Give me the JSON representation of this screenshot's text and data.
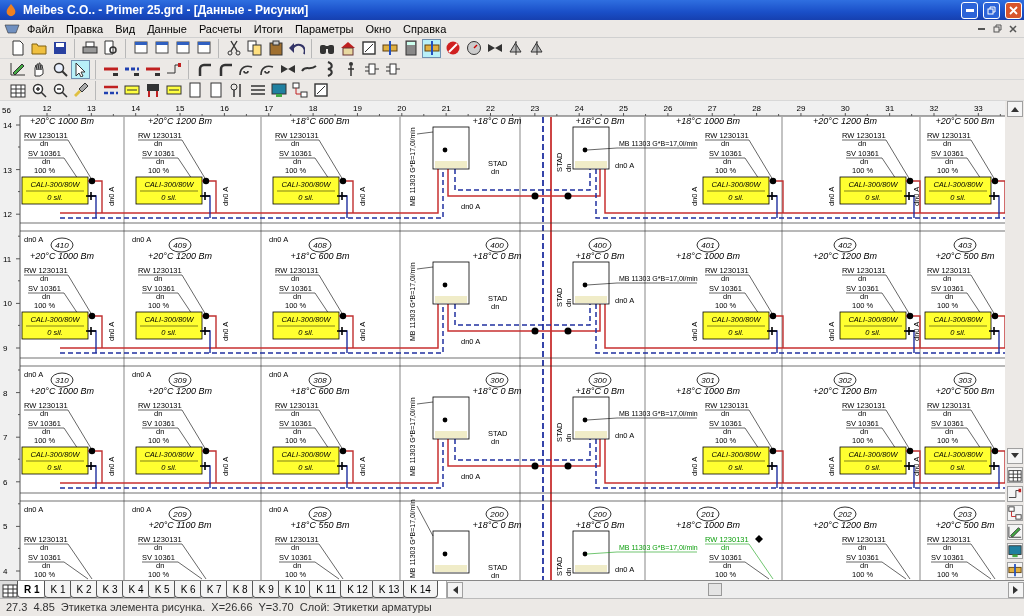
{
  "window": {
    "title": "Meibes C.O.. - Primer 25.grd - [Данные - Рисунки]"
  },
  "menu": [
    "Файл",
    "Правка",
    "Вид",
    "Данные",
    "Расчеты",
    "Итоги",
    "Параметры",
    "Окно",
    "Справка"
  ],
  "toolbars": [
    {
      "groups": [
        [
          {
            "kind": "document",
            "selected": false
          },
          {
            "kind": "folder",
            "selected": false
          },
          {
            "kind": "disk",
            "selected": false
          }
        ],
        [
          {
            "kind": "printer",
            "selected": false
          },
          {
            "kind": "preview",
            "selected": false
          }
        ],
        [
          {
            "kind": "window",
            "selected": false
          },
          {
            "kind": "window",
            "selected": false
          },
          {
            "kind": "window",
            "selected": false
          },
          {
            "kind": "window",
            "selected": false
          }
        ],
        [
          {
            "kind": "scissors",
            "selected": false
          },
          {
            "kind": "copy",
            "selected": false
          },
          {
            "kind": "clipboard",
            "selected": false
          },
          {
            "kind": "undo",
            "selected": false
          }
        ],
        [
          {
            "kind": "binoculars",
            "selected": false
          },
          {
            "kind": "house",
            "selected": false
          },
          {
            "kind": "frame",
            "selected": false
          },
          {
            "kind": "fitting",
            "selected": false
          },
          {
            "kind": "calculator",
            "selected": false
          },
          {
            "kind": "fitting",
            "selected": true
          },
          {
            "kind": "stop",
            "selected": false
          },
          {
            "kind": "gauge",
            "selected": false
          },
          {
            "kind": "valve",
            "selected": false
          },
          {
            "kind": "sail",
            "selected": false
          },
          {
            "kind": "sail",
            "selected": false
          }
        ]
      ]
    },
    {
      "groups": [
        [
          {
            "kind": "pen",
            "selected": false
          },
          {
            "kind": "hand",
            "selected": false
          },
          {
            "kind": "zoom",
            "selected": false
          },
          {
            "kind": "pointer",
            "selected": true
          }
        ],
        [
          {
            "kind": "redline",
            "selected": false
          },
          {
            "kind": "blueline",
            "selected": false
          },
          {
            "kind": "redline",
            "selected": false
          },
          {
            "kind": "connector",
            "selected": false
          }
        ],
        [
          {
            "kind": "bend",
            "selected": false
          },
          {
            "kind": "bend",
            "selected": false
          },
          {
            "kind": "curl",
            "selected": false
          },
          {
            "kind": "curl",
            "selected": false
          },
          {
            "kind": "valve",
            "selected": false
          },
          {
            "kind": "wave",
            "selected": false
          },
          {
            "kind": "hook",
            "selected": false
          },
          {
            "kind": "pin",
            "selected": false
          },
          {
            "kind": "manifold",
            "selected": false
          },
          {
            "kind": "manifold",
            "selected": false
          }
        ]
      ]
    },
    {
      "groups": [
        [
          {
            "kind": "grid",
            "selected": false
          },
          {
            "kind": "zoomin",
            "selected": false
          },
          {
            "kind": "zoomout",
            "selected": false
          },
          {
            "kind": "brush",
            "selected": false
          }
        ],
        [
          {
            "kind": "dualline",
            "selected": false
          },
          {
            "kind": "label",
            "selected": false
          },
          {
            "kind": "pump",
            "selected": false
          },
          {
            "kind": "label",
            "selected": false
          },
          {
            "kind": "panel",
            "selected": false
          },
          {
            "kind": "panel",
            "selected": false
          },
          {
            "kind": "probe",
            "selected": false
          },
          {
            "kind": "list",
            "selected": false
          },
          {
            "kind": "monitor",
            "selected": false
          },
          {
            "kind": "tree",
            "selected": false
          },
          {
            "kind": "frame",
            "selected": false
          }
        ]
      ]
    }
  ],
  "ruler": {
    "corner": "56",
    "columns": [
      "12",
      "13",
      "14",
      "15",
      "16",
      "17",
      "18",
      "19",
      "20",
      "21",
      "22",
      "23",
      "24",
      "25",
      "26",
      "27",
      "28",
      "29",
      "30",
      "31",
      "32",
      "33"
    ],
    "rows": [
      "14",
      "13",
      "12",
      "11",
      "10",
      "9",
      "8",
      "7",
      "6",
      "5",
      "4"
    ]
  },
  "bands": [
    {
      "rooms": [
        {
          "kind": "radiator",
          "temp": "+20°C 1000 Вт",
          "valve_top": "RW 1230131",
          "valve_top_size": "dn",
          "valve_bottom": "SV 10361",
          "valve_bottom_size": "dn",
          "setting": "100 %",
          "radiator": "CALI-300/80W",
          "radiator_sub": "0 sil.",
          "pipe_label": "dn0 A",
          "line_label": "dn0 A",
          "highlighted": false
        },
        {
          "kind": "radiator",
          "temp": "+20°C 1200 Вт",
          "valve_top": "RW 1230131",
          "valve_top_size": "dn",
          "valve_bottom": "SV 10361",
          "valve_bottom_size": "dn",
          "setting": "100 %",
          "radiator": "CALI-300/80W",
          "radiator_sub": "0 sil.",
          "pipe_label": "dn0 A",
          "line_label": "dn0 A",
          "highlighted": false
        },
        {
          "kind": "radiator",
          "temp": "+18°C 600 Вт",
          "valve_top": "RW 1230131",
          "valve_top_size": "dn",
          "valve_bottom": "SV 10361",
          "valve_bottom_size": "dn",
          "setting": "100 %",
          "radiator": "CALI-300/80W",
          "radiator_sub": "0 sil.",
          "pipe_label": "dn0 A",
          "line_label": "dn0 A",
          "highlighted": false
        },
        {
          "kind": "riser",
          "temp": "+18°C 0 Вт",
          "meter": "MB 11303 G*B=17,0l/min",
          "valve": "STAD",
          "valve_size": "dn",
          "pipe_label": "dn0 A",
          "highlighted": false
        },
        {
          "kind": "riser",
          "temp": "+18°C 0 Вт",
          "meter": "MB 11303 G*B=17,0l/min",
          "valve": "STAD",
          "valve_size": "dn",
          "pipe_label": "dn0 A",
          "highlighted": false
        },
        {
          "kind": "radiator",
          "temp": "+18°C 1000 Вт",
          "valve_top": "RW 1230131",
          "valve_top_size": "dn",
          "valve_bottom": "SV 10361",
          "valve_bottom_size": "dn",
          "setting": "100 %",
          "radiator": "CALI-300/80W",
          "radiator_sub": "0 sil.",
          "pipe_label": "dn0 A",
          "highlighted": false
        },
        {
          "kind": "radiator",
          "temp": "+20°C 1200 Вт",
          "valve_top": "RW 1230131",
          "valve_top_size": "dn",
          "valve_bottom": "SV 10361",
          "valve_bottom_size": "dn",
          "setting": "100 %",
          "radiator": "CALI-300/80W",
          "radiator_sub": "0 sil.",
          "pipe_label": "dn0 A",
          "highlighted": false
        },
        {
          "kind": "radiator",
          "temp": "+20°C 500 Вт",
          "valve_top": "RW 1230131",
          "valve_top_size": "dn",
          "valve_bottom": "SV 10361",
          "valve_bottom_size": "dn",
          "setting": "100 %",
          "radiator": "CALI-300/80W",
          "radiator_sub": "0 sil.",
          "pipe_label": "dn0 A",
          "highlighted": false
        }
      ]
    },
    {
      "rooms": [
        {
          "kind": "radiator",
          "number": "410",
          "temp": "+20°C 1000 Вт",
          "valve_top": "RW 1230131",
          "valve_top_size": "dn",
          "valve_bottom": "SV 10361",
          "valve_bottom_size": "dn",
          "setting": "100 %",
          "radiator": "CALI-300/80W",
          "radiator_sub": "0 sil.",
          "pipe_label": "dn0 A",
          "line_label": "dn0 A",
          "highlighted": false
        },
        {
          "kind": "radiator",
          "number": "409",
          "temp": "+20°C 1200 Вт",
          "valve_top": "RW 1230131",
          "valve_top_size": "dn",
          "valve_bottom": "SV 10361",
          "valve_bottom_size": "dn",
          "setting": "100 %",
          "radiator": "CALI-300/80W",
          "radiator_sub": "0 sil.",
          "pipe_label": "dn0 A",
          "line_label": "dn0 A",
          "highlighted": false
        },
        {
          "kind": "radiator",
          "number": "408",
          "temp": "+18°C 600 Вт",
          "valve_top": "RW 1230131",
          "valve_top_size": "dn",
          "valve_bottom": "SV 10361",
          "valve_bottom_size": "dn",
          "setting": "100 %",
          "radiator": "CALI-300/80W",
          "radiator_sub": "0 sil.",
          "pipe_label": "dn0 A",
          "line_label": "dn0 A",
          "highlighted": false
        },
        {
          "kind": "riser",
          "number": "400",
          "temp": "+18°C 0 Вт",
          "meter": "MB 11303 G*B=17,0l/min",
          "valve": "STAD",
          "valve_size": "dn",
          "pipe_label": "dn0 A",
          "highlighted": false
        },
        {
          "kind": "riser",
          "number": "400",
          "temp": "+18°C 0 Вт",
          "meter": "MB 11303 G*B=17,0l/min",
          "valve": "STAD",
          "valve_size": "dn",
          "pipe_label": "dn0 A",
          "highlighted": false
        },
        {
          "kind": "radiator",
          "number": "401",
          "temp": "+18°C 1000 Вт",
          "valve_top": "RW 1230131",
          "valve_top_size": "dn",
          "valve_bottom": "SV 10361",
          "valve_bottom_size": "dn",
          "setting": "100 %",
          "radiator": "CALI-300/80W",
          "radiator_sub": "0 sil.",
          "pipe_label": "dn0 A",
          "highlighted": false
        },
        {
          "kind": "radiator",
          "number": "402",
          "temp": "+20°C 1200 Вт",
          "valve_top": "RW 1230131",
          "valve_top_size": "dn",
          "valve_bottom": "SV 10361",
          "valve_bottom_size": "dn",
          "setting": "100 %",
          "radiator": "CALI-300/80W",
          "radiator_sub": "0 sil.",
          "pipe_label": "dn0 A",
          "highlighted": false
        },
        {
          "kind": "radiator",
          "number": "403",
          "temp": "+20°C 500 Вт",
          "valve_top": "RW 1230131",
          "valve_top_size": "dn",
          "valve_bottom": "SV 10361",
          "valve_bottom_size": "dn",
          "setting": "100 %",
          "radiator": "CALI-300/80W",
          "radiator_sub": "0 sil.",
          "pipe_label": "dn0 A",
          "highlighted": false
        }
      ]
    },
    {
      "rooms": [
        {
          "kind": "radiator",
          "number": "310",
          "temp": "+20°C 1000 Вт",
          "valve_top": "RW 1230131",
          "valve_top_size": "dn",
          "valve_bottom": "SV 10361",
          "valve_bottom_size": "dn",
          "setting": "100 %",
          "radiator": "CALI-300/80W",
          "radiator_sub": "0 sil.",
          "pipe_label": "dn0 A",
          "line_label": "dn0 A",
          "highlighted": false
        },
        {
          "kind": "radiator",
          "number": "309",
          "temp": "+20°C 1200 Вт",
          "valve_top": "RW 1230131",
          "valve_top_size": "dn",
          "valve_bottom": "SV 10361",
          "valve_bottom_size": "dn",
          "setting": "100 %",
          "radiator": "CALI-300/80W",
          "radiator_sub": "0 sil.",
          "pipe_label": "dn0 A",
          "line_label": "dn0 A",
          "highlighted": false
        },
        {
          "kind": "radiator",
          "number": "308",
          "temp": "+18°C 600 Вт",
          "valve_top": "RW 1230131",
          "valve_top_size": "dn",
          "valve_bottom": "SV 10361",
          "valve_bottom_size": "dn",
          "setting": "100 %",
          "radiator": "CALI-300/80W",
          "radiator_sub": "0 sil.",
          "pipe_label": "dn0 A",
          "line_label": "dn0 A",
          "highlighted": false
        },
        {
          "kind": "riser",
          "number": "300",
          "temp": "+18°C 0 Вт",
          "meter": "MB 11303 G*B=17,0l/min",
          "valve": "STAD",
          "valve_size": "dn",
          "pipe_label": "dn0 A",
          "highlighted": false
        },
        {
          "kind": "riser",
          "number": "300",
          "temp": "+18°C 0 Вт",
          "meter": "MB 11303 G*B=17,0l/min",
          "valve": "STAD",
          "valve_size": "dn",
          "pipe_label": "dn0 A",
          "highlighted": false
        },
        {
          "kind": "radiator",
          "number": "301",
          "temp": "+18°C 1000 Вт",
          "valve_top": "RW 1230131",
          "valve_top_size": "dn",
          "valve_bottom": "SV 10361",
          "valve_bottom_size": "dn",
          "setting": "100 %",
          "radiator": "CALI-300/80W",
          "radiator_sub": "0 sil.",
          "pipe_label": "dn0 A",
          "highlighted": false
        },
        {
          "kind": "radiator",
          "number": "302",
          "temp": "+20°C 1200 Вт",
          "valve_top": "RW 1230131",
          "valve_top_size": "dn",
          "valve_bottom": "SV 10361",
          "valve_bottom_size": "dn",
          "setting": "100 %",
          "radiator": "CALI-300/80W",
          "radiator_sub": "0 sil.",
          "pipe_label": "dn0 A",
          "highlighted": false
        },
        {
          "kind": "radiator",
          "number": "303",
          "temp": "+20°C 500 Вт",
          "valve_top": "RW 1230131",
          "valve_top_size": "dn",
          "valve_bottom": "SV 10361",
          "valve_bottom_size": "dn",
          "setting": "100 %",
          "radiator": "CALI-300/80W",
          "radiator_sub": "0 sil.",
          "pipe_label": "dn0 A",
          "highlighted": false
        }
      ]
    },
    {
      "rooms": [
        {
          "kind": "radiator",
          "valve_top": "RW 1230131",
          "valve_top_size": "dn",
          "valve_bottom": "SV 10361",
          "valve_bottom_size": "dn",
          "setting": "100 %",
          "highlighted": false
        },
        {
          "kind": "radiator",
          "number": "209",
          "temp": "+20°C 1100 Вт",
          "valve_top": "RW 1230131",
          "valve_top_size": "dn",
          "valve_bottom": "SV 10361",
          "valve_bottom_size": "dn",
          "setting": "100 %",
          "highlighted": false
        },
        {
          "kind": "radiator",
          "number": "208",
          "temp": "+18°C 550 Вт",
          "valve_top": "RW 1230131",
          "valve_top_size": "dn",
          "valve_bottom": "SV 10361",
          "valve_bottom_size": "dn",
          "setting": "100 %",
          "highlighted": false
        },
        {
          "kind": "riser",
          "number": "200",
          "temp": "+18°C 0 Вт",
          "meter": "MB 11303 G*B=17,0l/min",
          "valve": "STAD",
          "valve_size": "dn",
          "highlighted": false
        },
        {
          "kind": "riser",
          "number": "200",
          "temp": "+18°C 0 Вт",
          "meter": "MB 11303 G*B=17,0l/min",
          "valve": "STAD",
          "valve_size": "dn",
          "pipe_label": "dn0 A",
          "highlighted": true
        },
        {
          "kind": "radiator",
          "number": "201",
          "temp": "+18°C 1000 Вт",
          "valve_top": "RW 1230131",
          "valve_top_size": "dn",
          "valve_bottom": "SV 10361",
          "valve_bottom_size": "dn",
          "setting": "100 %",
          "highlighted": true
        },
        {
          "kind": "radiator",
          "number": "202",
          "temp": "+20°C 1200 Вт",
          "valve_top": "RW 1230131",
          "valve_top_size": "dn",
          "valve_bottom": "SV 10361",
          "valve_bottom_size": "dn",
          "setting": "100 %",
          "highlighted": false
        },
        {
          "kind": "radiator",
          "number": "203",
          "temp": "+20°C 500 Вт",
          "valve_top": "RW 1230131",
          "valve_top_size": "dn",
          "valve_bottom": "SV 10361",
          "valve_bottom_size": "dn",
          "setting": "100 %",
          "highlighted": false
        }
      ]
    }
  ],
  "sheet_tabs": [
    {
      "label": "R 1",
      "selected": true
    },
    {
      "label": "K 1",
      "selected": false
    },
    {
      "label": "K 2",
      "selected": false
    },
    {
      "label": "K 3",
      "selected": false
    },
    {
      "label": "K 4",
      "selected": false
    },
    {
      "label": "K 5",
      "selected": false
    },
    {
      "label": "K 6",
      "selected": false
    },
    {
      "label": "K 7",
      "selected": false
    },
    {
      "label": "K 8",
      "selected": false
    },
    {
      "label": "K 9",
      "selected": false
    },
    {
      "label": "K 10",
      "selected": false
    },
    {
      "label": "K 11",
      "selected": false
    },
    {
      "label": "K 12",
      "selected": false
    },
    {
      "label": "K 13",
      "selected": false
    },
    {
      "label": "K 14",
      "selected": false
    }
  ],
  "status_bar": {
    "fields": [
      "27.3",
      "4.85"
    ],
    "message": "Этикетка элемента рисунка.  X=26.66  Y=3.70  Слой: Этикетки арматуры"
  }
}
